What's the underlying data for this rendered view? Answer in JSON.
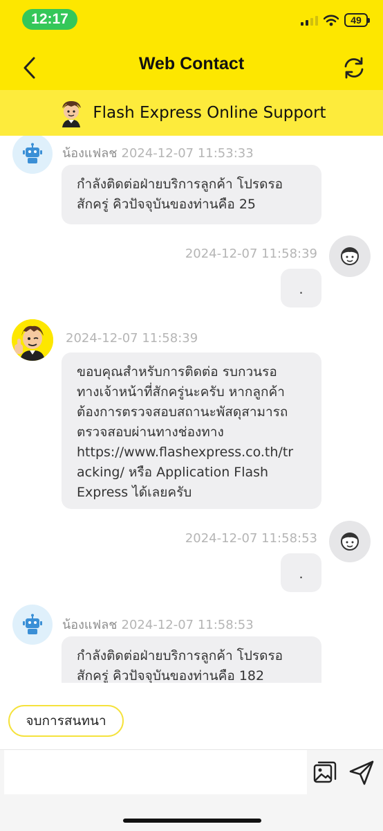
{
  "status": {
    "time": "12:17",
    "battery": "49"
  },
  "nav": {
    "title": "Web Contact",
    "back_icon": "chevron-left-icon",
    "refresh_icon": "refresh-icon"
  },
  "banner": {
    "text": "Flash Express Online Support"
  },
  "messages": [
    {
      "sender": "bot",
      "name": "น้องแฟลช",
      "time": "2024-12-07 11:53:33",
      "lines": [
        "กำลังติดต่อฝ่ายบริการลูกค้า โปรดรอ",
        "สักครู่ คิวปัจจุบันของท่านคือ 25"
      ]
    },
    {
      "sender": "user",
      "time": "2024-12-07 11:58:39",
      "text": "."
    },
    {
      "sender": "agent",
      "time": "2024-12-07 11:58:39",
      "lines": [
        "ขอบคุณสำหรับการติดต่อ รบกวนรอ",
        "ทางเจ้าหน้าที่สักครู่นะครับ หากลูกค้า",
        "ต้องการตรวจสอบสถานะพัสดุสามารถ",
        "ตรวจสอบผ่านทางช่องทาง",
        "https://www.flashexpress.co.th/tr",
        "acking/ หรือ Application Flash",
        "Express ได้เลยครับ"
      ]
    },
    {
      "sender": "user",
      "time": "2024-12-07 11:58:53",
      "text": "."
    },
    {
      "sender": "bot",
      "name": "น้องแฟลช",
      "time": "2024-12-07 11:58:53",
      "lines": [
        "กำลังติดต่อฝ่ายบริการลูกค้า โปรดรอ",
        "สักครู่ คิวปัจจุบันของท่านคือ 182"
      ]
    }
  ],
  "actions": {
    "end_chat": "จบการสนทนา"
  },
  "input": {
    "placeholder": "",
    "value": ""
  },
  "colors": {
    "brand_yellow": "#fde700",
    "banner_yellow": "#fdeb3c",
    "bubble_gray": "#efeff1",
    "bot_avatar_bg": "#dff0fb",
    "bot_blue": "#3a8fd6"
  }
}
